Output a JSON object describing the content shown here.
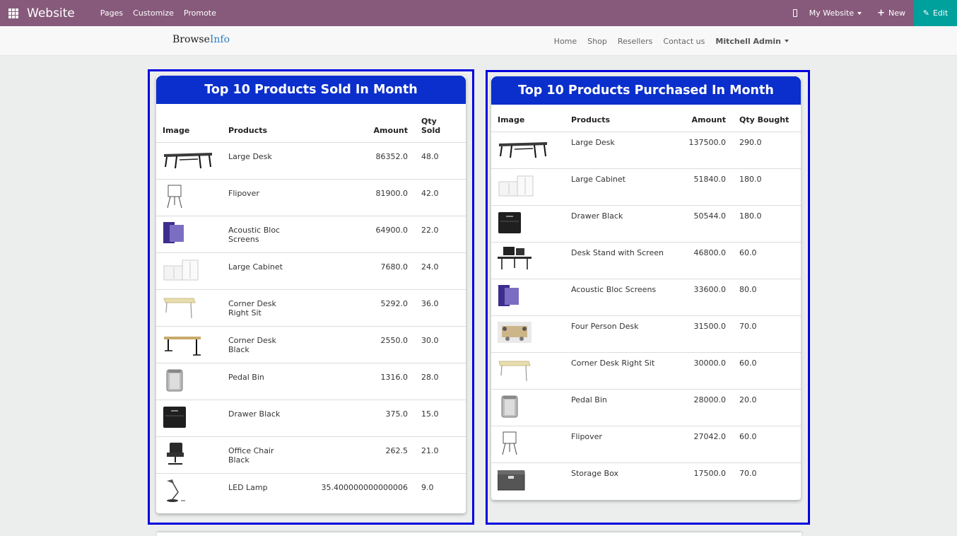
{
  "topbar": {
    "brand": "Website",
    "menu": [
      "Pages",
      "Customize",
      "Promote"
    ],
    "site_selector": "My Website",
    "new_label": "New",
    "edit_label": "Edit",
    "colors": {
      "bar": "#875a7b",
      "edit": "#00a09d"
    }
  },
  "header": {
    "logo_part1": "Browse",
    "logo_part2": "Info",
    "nav": [
      "Home",
      "Shop",
      "Resellers",
      "Contact us"
    ],
    "user": "Mitchell Admin"
  },
  "sold": {
    "title": "Top 10 Products Sold In Month",
    "columns": [
      "Image",
      "Products",
      "Amount",
      "Qty Sold"
    ],
    "rows": [
      {
        "image": "desk-large-icon",
        "product": "Large Desk",
        "amount": "86352.0",
        "qty": "48.0"
      },
      {
        "image": "flipover-icon",
        "product": "Flipover",
        "amount": "81900.0",
        "qty": "42.0"
      },
      {
        "image": "acoustic-screen-icon",
        "product": "Acoustic Bloc Screens",
        "amount": "64900.0",
        "qty": "22.0"
      },
      {
        "image": "cabinet-icon",
        "product": "Large Cabinet",
        "amount": "7680.0",
        "qty": "24.0"
      },
      {
        "image": "corner-desk-light-icon",
        "product": "Corner Desk Right Sit",
        "amount": "5292.0",
        "qty": "36.0"
      },
      {
        "image": "corner-desk-black-icon",
        "product": "Corner Desk Black",
        "amount": "2550.0",
        "qty": "30.0"
      },
      {
        "image": "pedal-bin-icon",
        "product": "Pedal Bin",
        "amount": "1316.0",
        "qty": "28.0"
      },
      {
        "image": "drawer-black-icon",
        "product": "Drawer Black",
        "amount": "375.0",
        "qty": "15.0"
      },
      {
        "image": "office-chair-icon",
        "product": "Office Chair Black",
        "amount": "262.5",
        "qty": "21.0"
      },
      {
        "image": "led-lamp-icon",
        "product": "LED Lamp",
        "amount": "35.400000000000006",
        "qty": "9.0"
      }
    ]
  },
  "purchased": {
    "title": "Top 10 Products Purchased In Month",
    "columns": [
      "Image",
      "Products",
      "Amount",
      "Qty Bought"
    ],
    "rows": [
      {
        "image": "desk-large-icon",
        "product": "Large Desk",
        "amount": "137500.0",
        "qty": "290.0"
      },
      {
        "image": "cabinet-icon",
        "product": "Large Cabinet",
        "amount": "51840.0",
        "qty": "180.0"
      },
      {
        "image": "drawer-black-icon",
        "product": "Drawer Black",
        "amount": "50544.0",
        "qty": "180.0"
      },
      {
        "image": "desk-stand-screen-icon",
        "product": "Desk Stand with Screen",
        "amount": "46800.0",
        "qty": "60.0"
      },
      {
        "image": "acoustic-screen-icon",
        "product": "Acoustic Bloc Screens",
        "amount": "33600.0",
        "qty": "80.0"
      },
      {
        "image": "four-person-desk-icon",
        "product": "Four Person Desk",
        "amount": "31500.0",
        "qty": "70.0"
      },
      {
        "image": "corner-desk-light-icon",
        "product": "Corner Desk Right Sit",
        "amount": "30000.0",
        "qty": "60.0"
      },
      {
        "image": "pedal-bin-icon",
        "product": "Pedal Bin",
        "amount": "28000.0",
        "qty": "20.0"
      },
      {
        "image": "flipover-icon",
        "product": "Flipover",
        "amount": "27042.0",
        "qty": "60.0"
      },
      {
        "image": "storage-box-icon",
        "product": "Storage Box",
        "amount": "17500.0",
        "qty": "70.0"
      }
    ]
  }
}
